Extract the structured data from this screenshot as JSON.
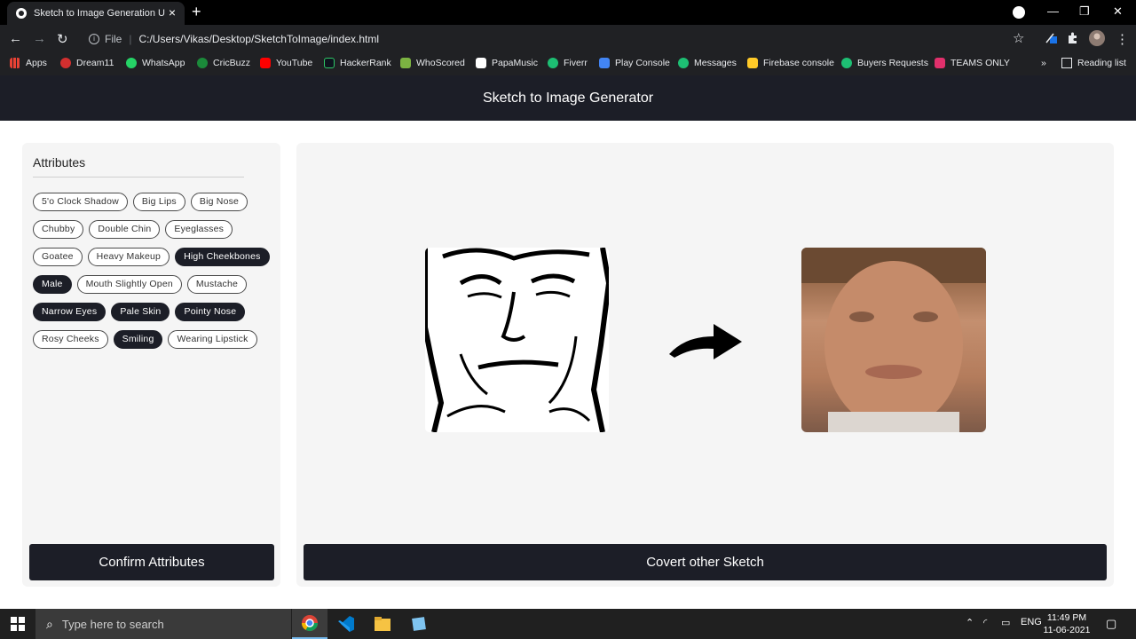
{
  "browser": {
    "tab_title": "Sketch to Image Generation Usin",
    "new_tab": "+",
    "url_scheme": "File",
    "url": "C:/Users/Vikas/Desktop/SketchToImage/index.html",
    "bookmarks": [
      {
        "label": "Apps",
        "color": "#e94235"
      },
      {
        "label": "Dream11",
        "color": "#d32f2f"
      },
      {
        "label": "WhatsApp",
        "color": "#25d366"
      },
      {
        "label": "CricBuzz",
        "color": "#1b8a3a"
      },
      {
        "label": "YouTube",
        "color": "#ff0000"
      },
      {
        "label": "HackerRank",
        "color": "#2ec866"
      },
      {
        "label": "WhoScored",
        "color": "#7cb342"
      },
      {
        "label": "PapaMusic",
        "color": "#ffffff"
      },
      {
        "label": "Fiverr",
        "color": "#1dbf73"
      },
      {
        "label": "Play Console",
        "color": "#4285f4"
      },
      {
        "label": "Messages",
        "color": "#1dbf73"
      },
      {
        "label": "Firebase console",
        "color": "#ffca28"
      },
      {
        "label": "Buyers Requests",
        "color": "#1dbf73"
      },
      {
        "label": "TEAMS ONLY",
        "color": "#e1306c"
      }
    ],
    "more": "»",
    "reading_list": "Reading list"
  },
  "app": {
    "title": "Sketch to Image Generator",
    "attributes_title": "Attributes",
    "attributes": [
      {
        "label": "5'o Clock Shadow",
        "selected": false
      },
      {
        "label": "Big Lips",
        "selected": false
      },
      {
        "label": "Big Nose",
        "selected": false
      },
      {
        "label": "Chubby",
        "selected": false
      },
      {
        "label": "Double Chin",
        "selected": false
      },
      {
        "label": "Eyeglasses",
        "selected": false
      },
      {
        "label": "Goatee",
        "selected": false
      },
      {
        "label": "Heavy Makeup",
        "selected": false
      },
      {
        "label": "High Cheekbones",
        "selected": true
      },
      {
        "label": "Male",
        "selected": true
      },
      {
        "label": "Mouth Slightly Open",
        "selected": false
      },
      {
        "label": "Mustache",
        "selected": false
      },
      {
        "label": "Narrow Eyes",
        "selected": true
      },
      {
        "label": "Pale Skin",
        "selected": true
      },
      {
        "label": "Pointy Nose",
        "selected": true
      },
      {
        "label": "Rosy Cheeks",
        "selected": false
      },
      {
        "label": "Smiling",
        "selected": true
      },
      {
        "label": "Wearing Lipstick",
        "selected": false
      }
    ],
    "confirm_label": "Confirm Attributes",
    "convert_label": "Covert other Sketch"
  },
  "taskbar": {
    "search_placeholder": "Type here to search",
    "language": "ENG",
    "time": "11:49 PM",
    "date": "11-06-2021"
  }
}
